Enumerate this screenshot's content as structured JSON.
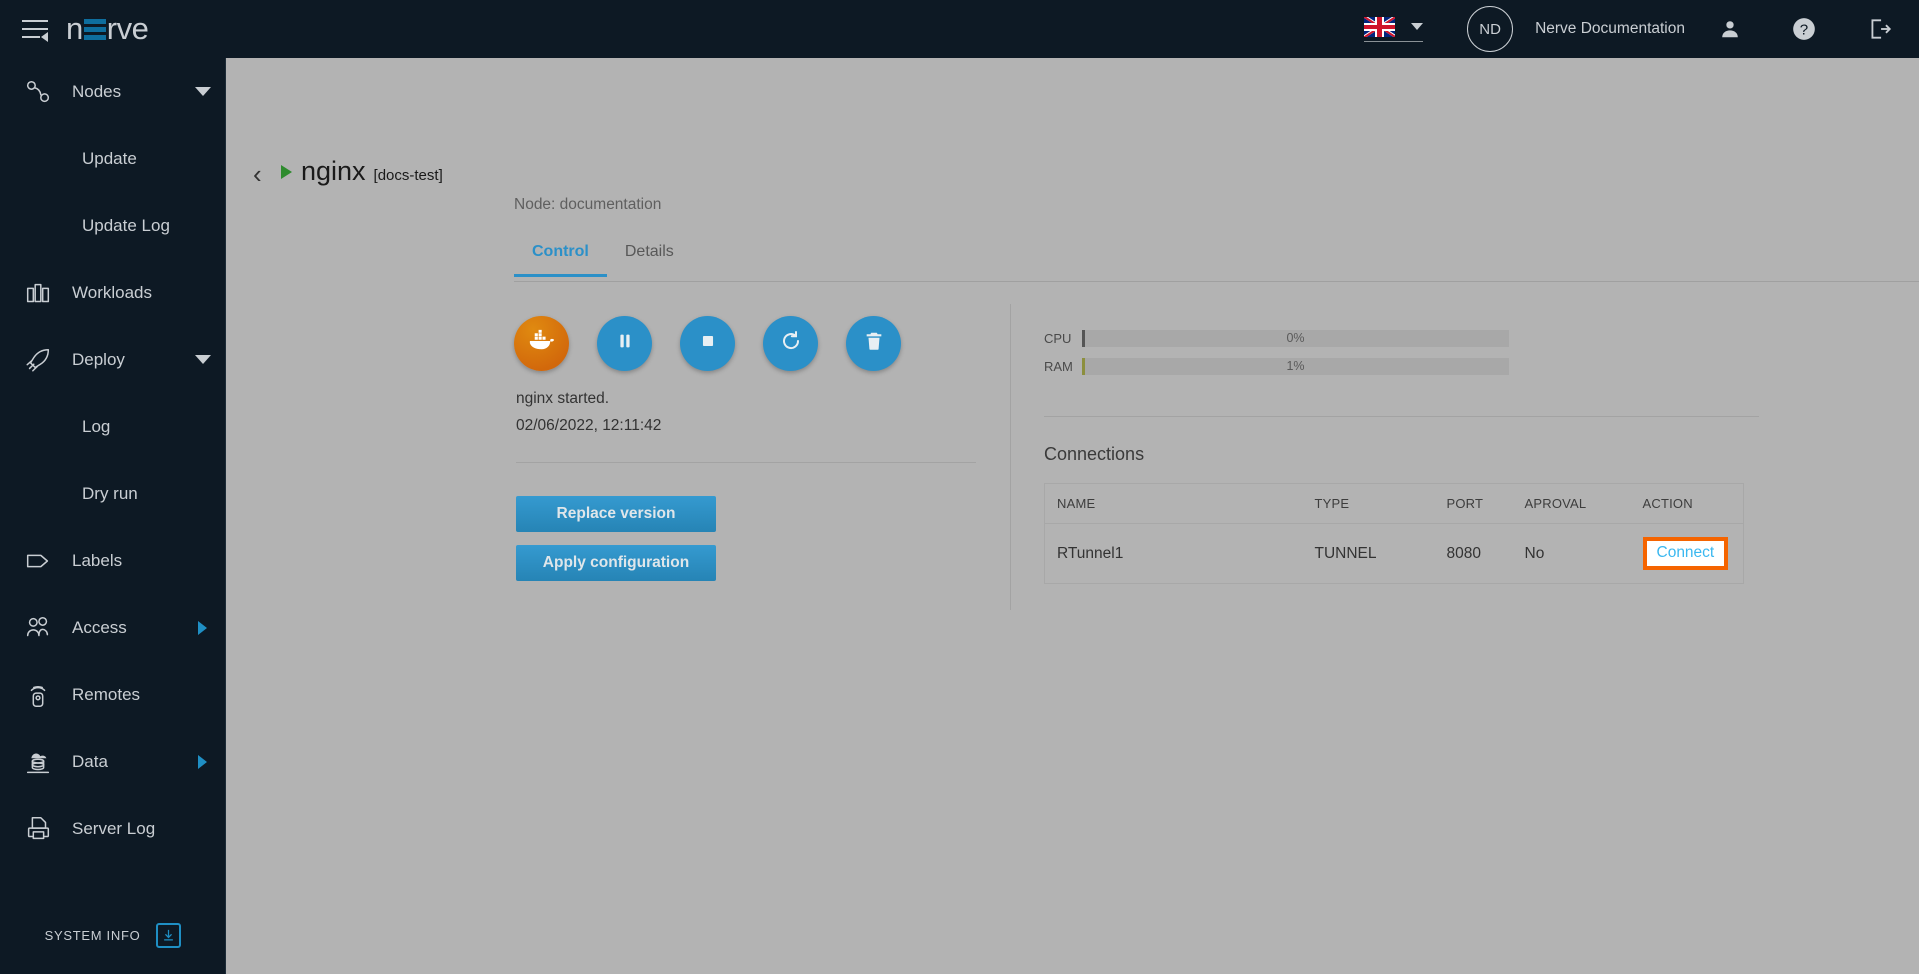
{
  "topbar": {
    "menu_icon": "hamburger-icon",
    "logo_text_left": "n",
    "logo_text_right": "rve",
    "language": {
      "flag": "uk-flag",
      "caret": "chevron-down-icon"
    },
    "avatar_initials": "ND",
    "username": "Nerve Documentation",
    "user_icon": "user-icon",
    "help_icon": "help-icon",
    "logout_icon": "logout-icon",
    "background": "#0d1924",
    "accent": "#0e6e9e"
  },
  "sidebar": {
    "items": [
      {
        "label": "Nodes",
        "icon": "nodes-icon",
        "sub": false,
        "expander": "down"
      },
      {
        "label": "Update",
        "icon": "",
        "sub": true,
        "expander": ""
      },
      {
        "label": "Update Log",
        "icon": "",
        "sub": true,
        "expander": ""
      },
      {
        "label": "Workloads",
        "icon": "workloads-icon",
        "sub": false,
        "expander": ""
      },
      {
        "label": "Deploy",
        "icon": "deploy-icon",
        "sub": false,
        "expander": "down"
      },
      {
        "label": "Log",
        "icon": "",
        "sub": true,
        "expander": ""
      },
      {
        "label": "Dry run",
        "icon": "",
        "sub": true,
        "expander": ""
      },
      {
        "label": "Labels",
        "icon": "labels-icon",
        "sub": false,
        "expander": ""
      },
      {
        "label": "Access",
        "icon": "access-icon",
        "sub": false,
        "expander": "right"
      },
      {
        "label": "Remotes",
        "icon": "remotes-icon",
        "sub": false,
        "expander": ""
      },
      {
        "label": "Data",
        "icon": "data-icon",
        "sub": false,
        "expander": "right"
      },
      {
        "label": "Server Log",
        "icon": "serverlog-icon",
        "sub": false,
        "expander": ""
      }
    ],
    "system_info": {
      "label": "SYSTEM INFO",
      "icon": "download-box-icon",
      "color": "#1f8fc4"
    }
  },
  "main": {
    "back_icon": "chevron-left-icon",
    "status_icon": "play-triangle-icon",
    "workload_name": "nginx",
    "workload_tag": "[docs-test]",
    "node_line": "Node: documentation",
    "tabs": [
      {
        "label": "Control",
        "active": true
      },
      {
        "label": "Details",
        "active": false
      }
    ],
    "control_buttons": [
      {
        "name": "docker-button",
        "icon": "docker-whale-icon",
        "style": "docker"
      },
      {
        "name": "pause-button",
        "icon": "pause-icon",
        "style": "blue"
      },
      {
        "name": "stop-button",
        "icon": "stop-icon",
        "style": "blue"
      },
      {
        "name": "restart-button",
        "icon": "restart-icon",
        "style": "blue"
      },
      {
        "name": "delete-button",
        "icon": "trash-icon",
        "style": "blue"
      }
    ],
    "status_message": "nginx started.",
    "status_timestamp": "02/06/2022, 12:11:42",
    "replace_version_label": "Replace version",
    "apply_configuration_label": "Apply configuration",
    "gauges": [
      {
        "label": "CPU",
        "value": "0%",
        "percent": 0,
        "indicator_color": "#555555"
      },
      {
        "label": "RAM",
        "value": "1%",
        "percent": 1,
        "indicator_color": "#8c8f3e"
      }
    ],
    "connections": {
      "title": "Connections",
      "columns": [
        "NAME",
        "TYPE",
        "PORT",
        "APROVAL",
        "ACTION"
      ],
      "rows": [
        {
          "name": "RTunnel1",
          "type": "TUNNEL",
          "port": "8080",
          "approval": "No",
          "action": "Connect"
        }
      ],
      "highlight_color": "#f56400",
      "link_color": "#3bb8f0"
    }
  }
}
